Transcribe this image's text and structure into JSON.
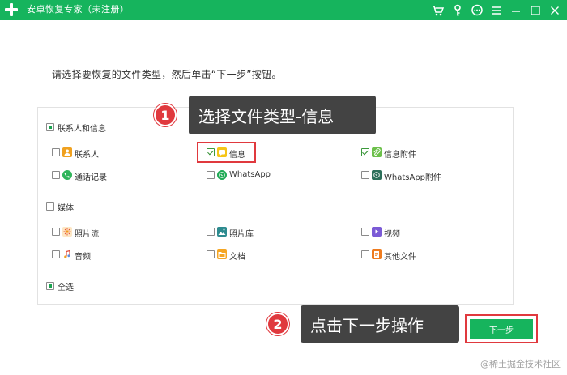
{
  "titlebar": {
    "title": "安卓恢复专家（未注册）",
    "icons": [
      "cart-icon",
      "key-icon",
      "chat-icon",
      "menu-icon",
      "minimize-icon",
      "maximize-icon",
      "close-icon"
    ]
  },
  "instruction": "请选择要恢复的文件类型，然后单击“下一步”按钮。",
  "groups": {
    "contacts": {
      "label": "联系人和信息",
      "state": "partial",
      "items": [
        {
          "label": "联系人",
          "checked": false,
          "icon": "contacts-icon"
        },
        {
          "label": "信息",
          "checked": true,
          "icon": "messages-icon"
        },
        {
          "label": "信息附件",
          "checked": true,
          "icon": "message-attachment-icon"
        },
        {
          "label": "通话记录",
          "checked": false,
          "icon": "call-log-icon"
        },
        {
          "label": "WhatsApp",
          "checked": false,
          "icon": "whatsapp-icon"
        },
        {
          "label": "WhatsApp附件",
          "checked": false,
          "icon": "whatsapp-attachment-icon"
        }
      ]
    },
    "media": {
      "label": "媒体",
      "state": "unchecked",
      "items": [
        {
          "label": "照片流",
          "checked": false,
          "icon": "photo-stream-icon"
        },
        {
          "label": "照片库",
          "checked": false,
          "icon": "photo-library-icon"
        },
        {
          "label": "视频",
          "checked": false,
          "icon": "video-icon"
        },
        {
          "label": "音频",
          "checked": false,
          "icon": "audio-icon"
        },
        {
          "label": "文档",
          "checked": false,
          "icon": "document-icon"
        },
        {
          "label": "其他文件",
          "checked": false,
          "icon": "other-files-icon"
        }
      ]
    },
    "select_all": {
      "label": "全选",
      "state": "partial"
    }
  },
  "callouts": {
    "step1": {
      "number": "1",
      "text": "选择文件类型-信息"
    },
    "step2": {
      "number": "2",
      "text": "点击下一步操作"
    }
  },
  "next_button": "下一步",
  "watermark": "@稀土掘金技术社区",
  "colors": {
    "brand_green": "#16b45d",
    "highlight_red": "#e0393e",
    "callout_bg": "#434343"
  }
}
